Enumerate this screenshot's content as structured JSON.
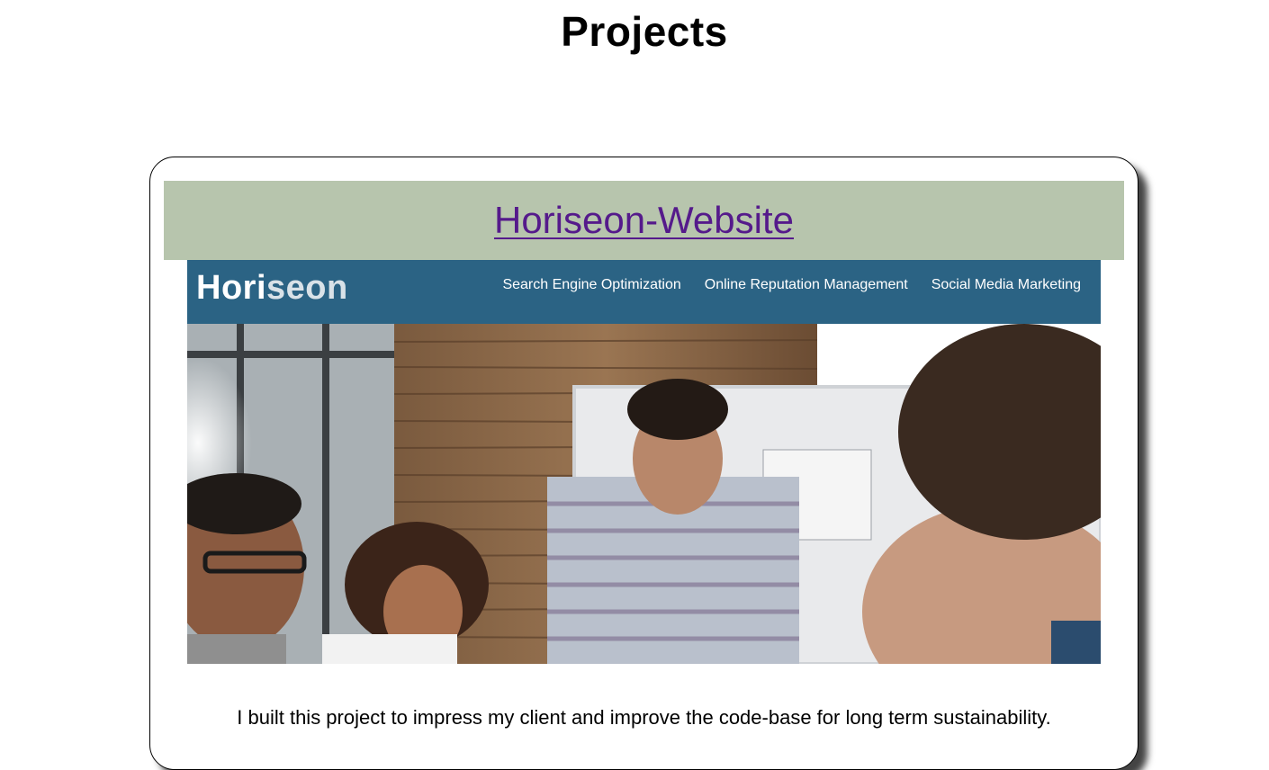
{
  "page": {
    "title": "Projects"
  },
  "project": {
    "link_label": "Horiseon-Website",
    "description": "I built this project to impress my client and improve the code-base for long term sustainability.",
    "screenshot": {
      "logo_bold": "Hori",
      "logo_light": "seon",
      "nav_items": [
        "Search Engine Optimization",
        "Online Reputation Management",
        "Social Media Marketing"
      ]
    }
  },
  "colors": {
    "header_band": "#b7c5ad",
    "link": "#551a8b",
    "screenshot_nav": "#2b6384"
  }
}
